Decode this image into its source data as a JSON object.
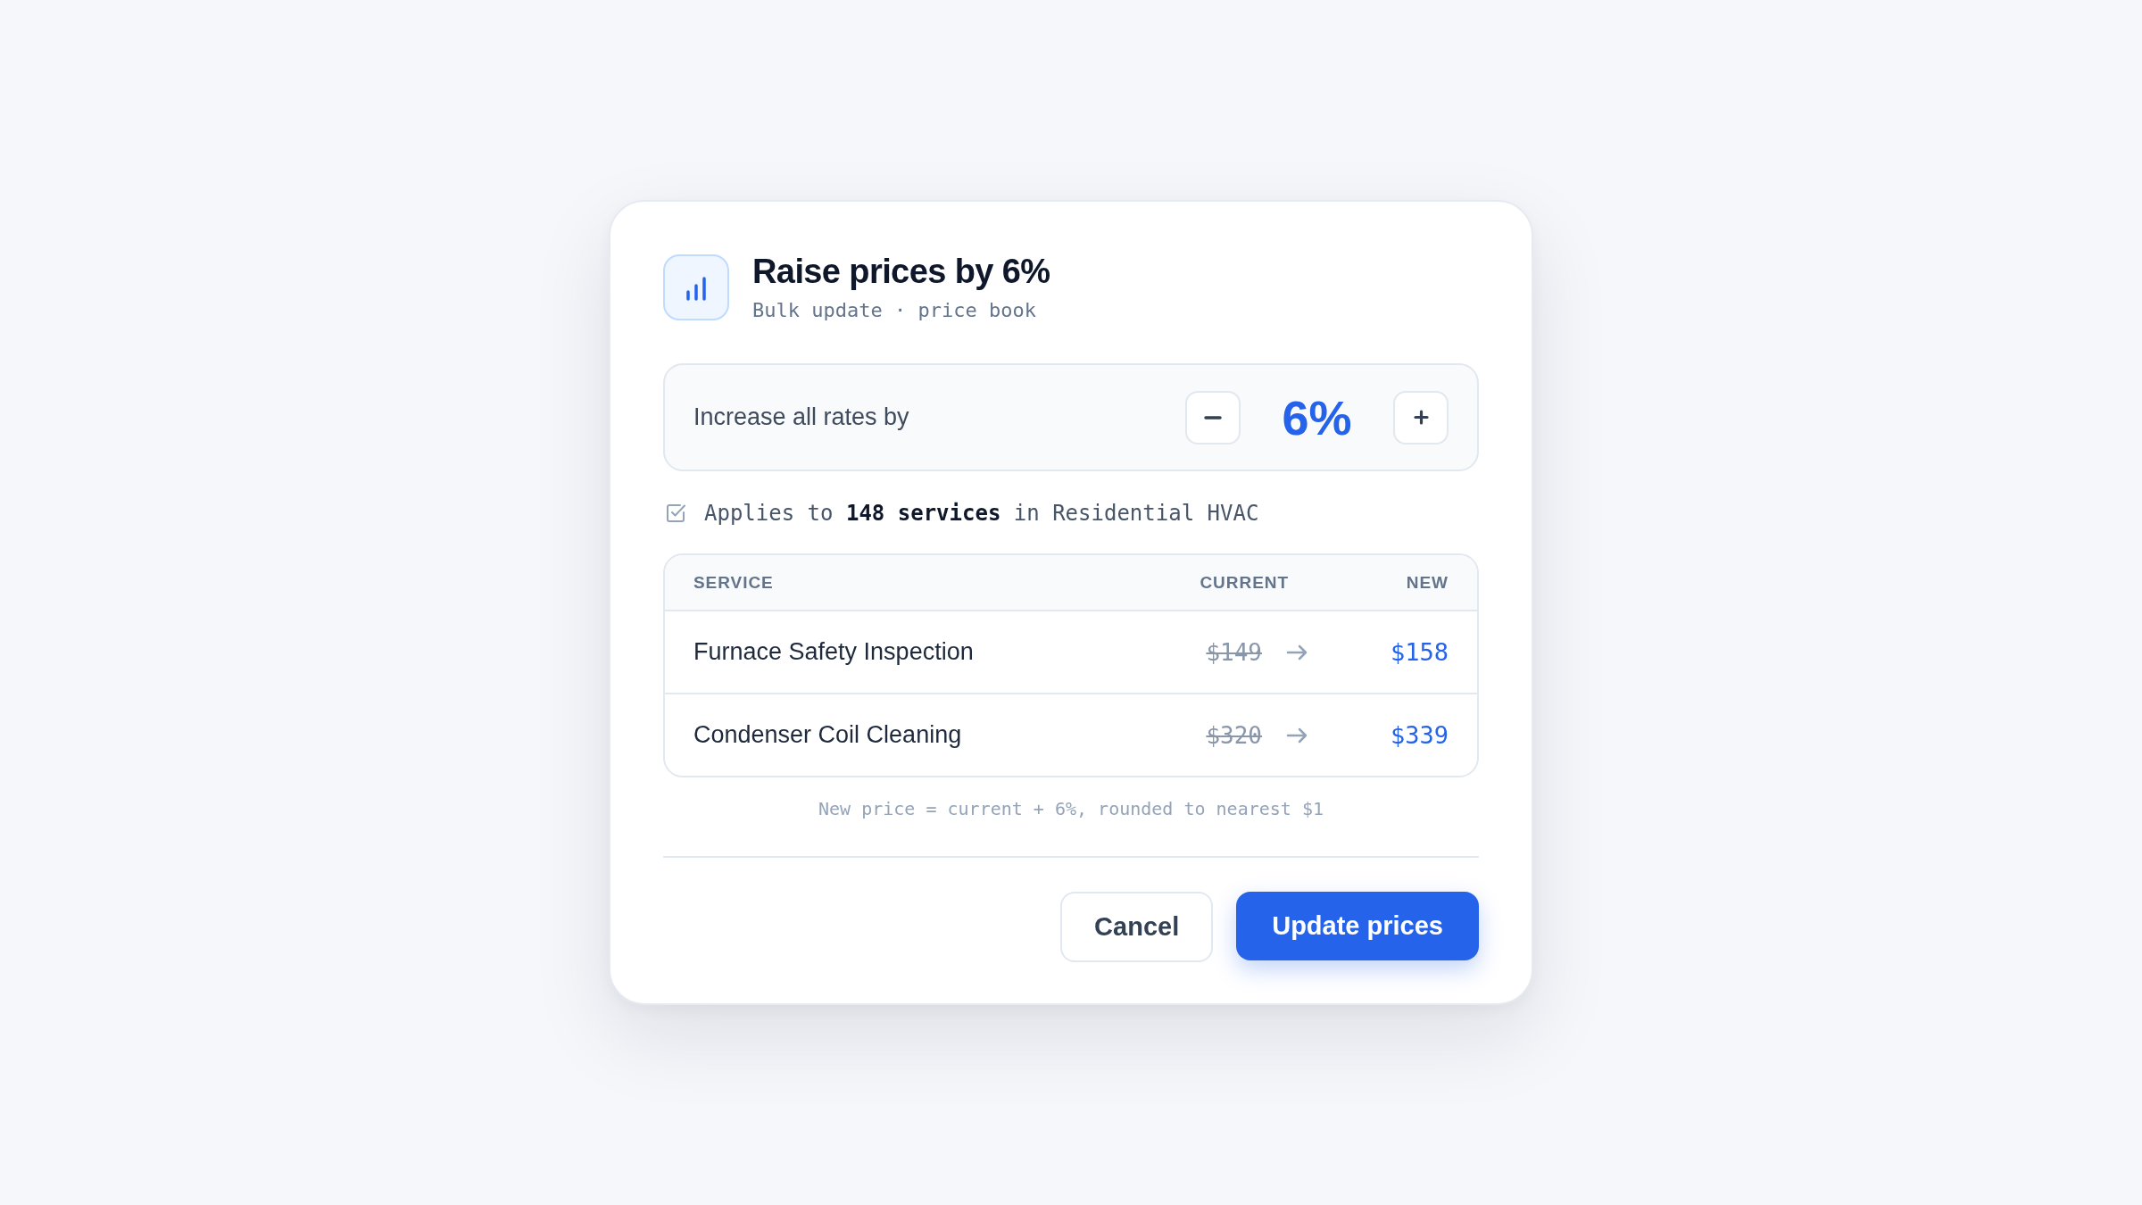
{
  "dialog": {
    "title": "Raise prices by 6%",
    "subtitle": "Bulk update · price book",
    "adjuster": {
      "label": "Increase all rates by",
      "value": "6%"
    },
    "scope": {
      "checked": true,
      "text": "Applies to **148 services** in Residential HVAC"
    },
    "table": {
      "columns": [
        "SERVICE",
        "CURRENT",
        "NEW"
      ],
      "rows": [
        {
          "service": "Furnace Safety Inspection",
          "current": "$149",
          "new": "$158"
        },
        {
          "service": "Condenser Coil Cleaning",
          "current": "$320",
          "new": "$339"
        }
      ]
    },
    "note": "New price = current + 6%, rounded to nearest $1",
    "buttons": [
      {
        "label": "Cancel",
        "kind": "secondary"
      },
      {
        "label": "Update prices",
        "kind": "primary"
      }
    ]
  }
}
